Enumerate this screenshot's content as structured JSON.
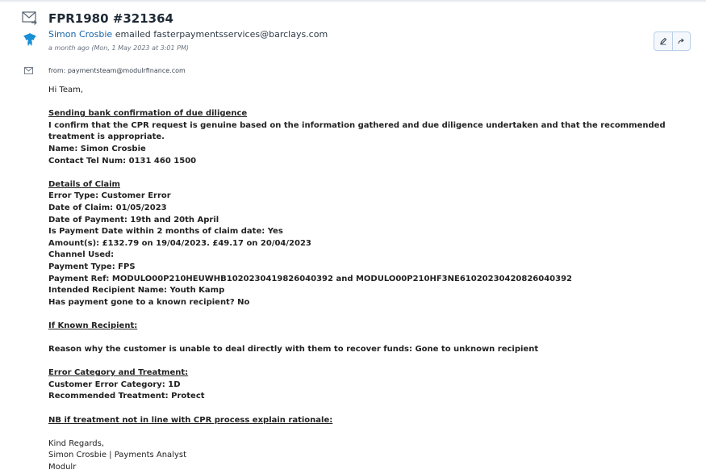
{
  "email": {
    "subject": "FPR1980 #321364",
    "sender_name": "Simon Crosbie",
    "sender_action": "emailed",
    "recipient": "fasterpaymentsservices@barclays.com",
    "timestamp": "a month ago (Mon, 1 May 2023 at 3:01 PM)",
    "from_line": "from: paymentsteam@modulrfinance.com"
  },
  "icons": {
    "mail": "mail-icon",
    "logo": "barclays-eagle-logo",
    "small_mail": "small-mail-icon",
    "edit": "pencil-icon",
    "forward": "forward-arrow-icon"
  },
  "colors": {
    "link": "#1565a8",
    "logo": "#1a8fd6",
    "action_border": "#b9cfe6"
  },
  "body": {
    "greeting": "Hi Team,",
    "section1_heading": "Sending bank confirmation of due diligence",
    "confirm_text": "I confirm that the CPR request is genuine based on the information gathered and due diligence undertaken and that the recommended treatment is appropriate.",
    "name_line": "Name: Simon Crosbie",
    "contact_line": "Contact Tel Num: 0131 460 1500",
    "section2_heading": "Details of Claim",
    "error_type": "Error Type: Customer Error",
    "date_of_claim": "Date of Claim: 01/05/2023",
    "date_of_payment": "Date of Payment: 19th and 20th April",
    "within_two_months": "Is Payment Date within 2 months of claim date: Yes",
    "amounts": "Amount(s): £132.79 on 19/04/2023. £49.17 on 20/04/2023",
    "channel_used": "Channel Used:",
    "payment_type": "Payment Type: FPS",
    "payment_ref": "Payment Ref: MODULO00P210HEUWHB1020230419826040392 and MODULO00P210HF3NE61020230420826040392",
    "intended_recipient": "Intended Recipient Name: Youth Kamp",
    "known_recipient_q": "Has payment gone to a known recipient? No",
    "section3_heading": "If Known Recipient:",
    "reason_line": "Reason why the customer is unable to deal directly with them to recover funds: Gone to unknown recipient",
    "section4_heading": "Error Category and Treatment:",
    "customer_error_category": "Customer Error Category: 1D",
    "recommended_treatment": "Recommended Treatment: Protect",
    "section5_heading": "NB if treatment not in line with CPR process explain rationale:",
    "signoff": "Kind Regards,",
    "signature_name": "Simon Crosbie |  Payments Analyst",
    "signature_company": "Modulr"
  }
}
